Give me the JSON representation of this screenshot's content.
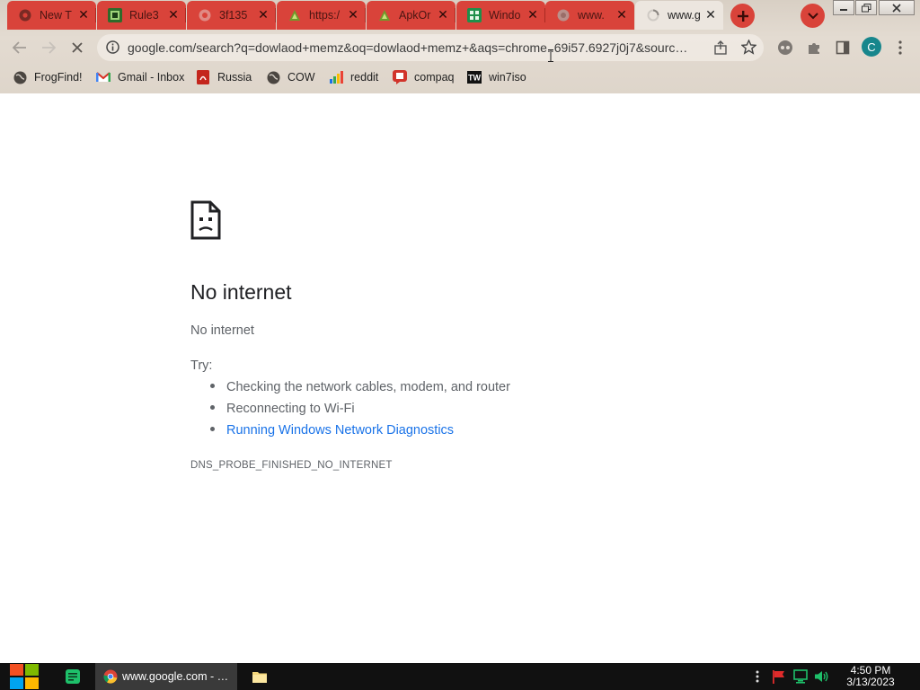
{
  "colors": {
    "tab_bg": "#d9433a",
    "active_tab_bg": "#ece6df",
    "link": "#1a73e8",
    "body_text": "#5f6368",
    "heading": "#202124",
    "taskbar": "#111111",
    "profile": "#17868c"
  },
  "tabs": [
    {
      "title": "New T",
      "icon": "chrome-icon",
      "active": false
    },
    {
      "title": "Rule3",
      "icon": "rule34-icon",
      "active": false
    },
    {
      "title": "3f135",
      "icon": "globe-icon",
      "active": false
    },
    {
      "title": "https:/",
      "icon": "apk-icon",
      "active": false
    },
    {
      "title": "ApkOr",
      "icon": "apk-icon",
      "active": false
    },
    {
      "title": "Windo",
      "icon": "windows-icon",
      "active": false
    },
    {
      "title": "www.",
      "icon": "globe-icon",
      "active": false
    },
    {
      "title": "www.g",
      "icon": "loading-spinner-icon",
      "active": true
    }
  ],
  "toolbar": {
    "url": "google.com/search?q=dowlaod+memz&oq=dowlaod+memz+&aqs=chrome..69i57.6927j0j7&sourc…",
    "profile_initial": "C"
  },
  "bookmarks": [
    {
      "label": "FrogFind!",
      "icon": "globe-icon"
    },
    {
      "label": "Gmail - Inbox",
      "icon": "gmail-icon"
    },
    {
      "label": "Russia",
      "icon": "pdf-icon"
    },
    {
      "label": "COW",
      "icon": "globe-icon"
    },
    {
      "label": "reddit",
      "icon": "reddit-icon"
    },
    {
      "label": "compaq",
      "icon": "compaq-icon"
    },
    {
      "label": "win7iso",
      "icon": "tw-icon"
    }
  ],
  "error_page": {
    "title": "No internet",
    "subtitle": "No internet",
    "try_label": "Try:",
    "suggestions": [
      {
        "text": "Checking the network cables, modem, and router",
        "link": false
      },
      {
        "text": "Reconnecting to Wi-Fi",
        "link": false
      },
      {
        "text": "Running Windows Network Diagnostics",
        "link": true
      }
    ],
    "error_code": "DNS_PROBE_FINISHED_NO_INTERNET"
  },
  "taskbar": {
    "chrome_task_label": "www.google.com - …",
    "time": "4:50 PM",
    "date": "3/13/2023"
  }
}
